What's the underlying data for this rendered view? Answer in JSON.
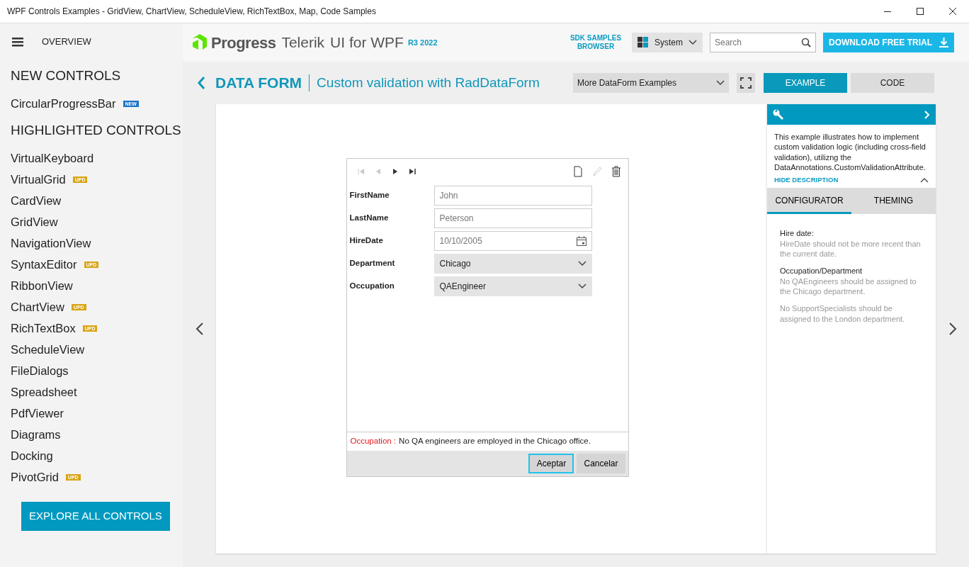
{
  "window": {
    "title": "WPF Controls Examples - GridView, ChartView, ScheduleView, RichTextBox, Map, Code Samples"
  },
  "sidebar": {
    "overview": "OVERVIEW",
    "sections": [
      {
        "heading": "NEW CONTROLS",
        "items": [
          {
            "label": "CircularProgressBar",
            "badge": {
              "text": "NEW",
              "color": "#1a73c8"
            }
          }
        ]
      },
      {
        "heading": "HIGHLIGHTED CONTROLS",
        "items": [
          {
            "label": "VirtualKeyboard"
          },
          {
            "label": "VirtualGrid",
            "badge": {
              "text": "UPD",
              "color": "#d9a514"
            }
          },
          {
            "label": "CardView"
          },
          {
            "label": "GridView"
          },
          {
            "label": "NavigationView"
          },
          {
            "label": "SyntaxEditor",
            "badge": {
              "text": "UPD",
              "color": "#d9a514"
            }
          },
          {
            "label": "RibbonView"
          },
          {
            "label": "ChartView",
            "badge": {
              "text": "UPD",
              "color": "#d9a514"
            }
          },
          {
            "label": "RichTextBox",
            "badge": {
              "text": "UPD",
              "color": "#d9a514"
            }
          },
          {
            "label": "ScheduleView"
          },
          {
            "label": "FileDialogs"
          },
          {
            "label": "Spreadsheet"
          },
          {
            "label": "PdfViewer"
          },
          {
            "label": "Diagrams"
          },
          {
            "label": "Docking"
          },
          {
            "label": "PivotGrid",
            "badge": {
              "text": "UPD",
              "color": "#d9a514"
            }
          }
        ]
      }
    ],
    "explore_button": "EXPLORE ALL CONTROLS"
  },
  "header": {
    "brand": "Progress",
    "product": "Telerik",
    "suffix": "UI for WPF",
    "version": "R3 2022",
    "sdk_link": "SDK SAMPLES BROWSER",
    "theme_dropdown": "System",
    "search": {
      "placeholder": "Search"
    },
    "download_button": "DOWNLOAD FREE TRIAL"
  },
  "page": {
    "category": "DATA FORM",
    "title": "Custom validation with RadDataForm",
    "examples_dropdown": "More DataForm Examples",
    "view_tabs": [
      {
        "label": "EXAMPLE",
        "selected": true
      },
      {
        "label": "CODE",
        "selected": false
      }
    ]
  },
  "data_form": {
    "nav": [
      {
        "kind": "first",
        "disabled": true
      },
      {
        "kind": "prev",
        "disabled": true
      },
      {
        "kind": "next",
        "disabled": false
      },
      {
        "kind": "last",
        "disabled": false
      }
    ],
    "actions": [
      {
        "kind": "new",
        "disabled": false
      },
      {
        "kind": "edit",
        "disabled": true
      },
      {
        "kind": "delete",
        "disabled": false
      }
    ],
    "fields": [
      {
        "label": "FirstName",
        "kind": "text",
        "value": "John"
      },
      {
        "label": "LastName",
        "kind": "text",
        "value": "Peterson"
      },
      {
        "label": "HireDate",
        "kind": "date",
        "value": "10/10/2005"
      },
      {
        "label": "Department",
        "kind": "combo",
        "value": "Chicago"
      },
      {
        "label": "Occupation",
        "kind": "combo",
        "value": "QAEngineer"
      }
    ],
    "error": {
      "field": "Occupation :",
      "message": "No QA engineers are employed in the Chicago office."
    },
    "buttons": [
      {
        "label": "Aceptar",
        "focused": true
      },
      {
        "label": "Cancelar",
        "focused": false
      }
    ]
  },
  "description_panel": {
    "text": "This example illustrates how to implement custom validation logic (including cross-field validation), utilizng the DataAnnotations.CustomValidationAttribute.",
    "toggle": "HIDE DESCRIPTION",
    "tabs": [
      {
        "label": "CONFIGURATOR",
        "selected": true
      },
      {
        "label": "THEMING",
        "selected": false
      }
    ],
    "notes": [
      {
        "heading": "Hire date:",
        "lines": [
          "HireDate should not be more recent than the current date."
        ]
      },
      {
        "heading": "Occupation/Department",
        "lines": [
          "No QAEngineers should be assigned to the Chicago department.",
          "No SupportSpecialists should be assigned to the London department."
        ]
      }
    ]
  }
}
